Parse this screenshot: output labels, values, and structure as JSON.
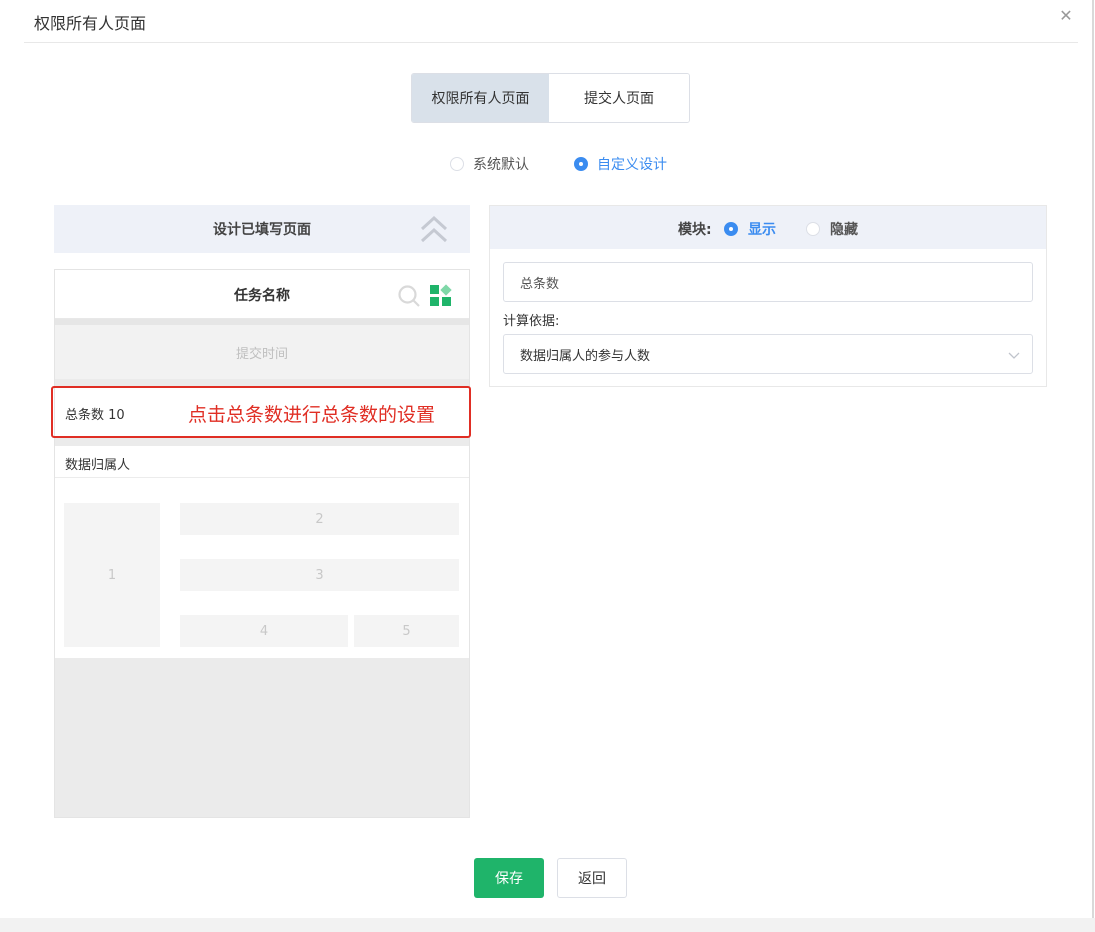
{
  "dialog": {
    "title": "权限所有人页面",
    "close_icon": "close-icon"
  },
  "segmented": {
    "tabs": [
      {
        "label": "权限所有人页面",
        "active": true
      },
      {
        "label": "提交人页面",
        "active": false
      }
    ]
  },
  "design_mode": {
    "options": [
      {
        "label": "系统默认",
        "checked": false
      },
      {
        "label": "自定义设计",
        "checked": true
      }
    ]
  },
  "left_panel": {
    "header": "设计已填写页面",
    "collapse_icon": "double-chevron-up-icon",
    "phone": {
      "title": "任务名称",
      "search_icon": "search-icon",
      "apps_icon": "apps-icon",
      "submit_time": "提交时间",
      "count_label": "总条数 10",
      "owner_label": "数据归属人",
      "blocks": [
        "1",
        "2",
        "3",
        "4",
        "5"
      ]
    }
  },
  "annotation": {
    "text": "点击总条数进行总条数的设置",
    "color": "#e02e24"
  },
  "right_panel": {
    "module_label": "模块:",
    "visibility": [
      {
        "label": "显示",
        "checked": true
      },
      {
        "label": "隐藏",
        "checked": false
      }
    ],
    "name_input_value": "总条数",
    "calc_label": "计算依据:",
    "calc_select_value": "数据归属人的参与人数",
    "select_icon": "chevron-down-icon"
  },
  "footer": {
    "save_label": "保存",
    "back_label": "返回"
  },
  "colors": {
    "primary_green": "#1fb46a",
    "accent_blue": "#3b8cf0",
    "annotation_red": "#e02e24",
    "header_bg": "#eef1f8"
  }
}
